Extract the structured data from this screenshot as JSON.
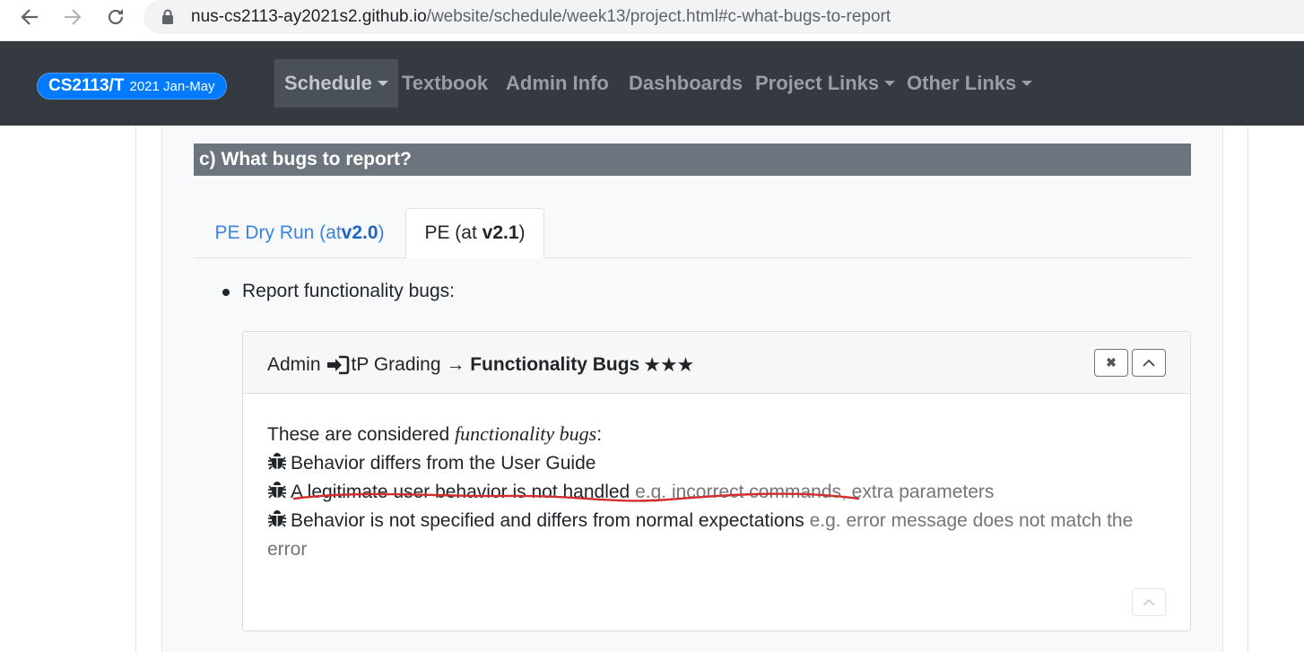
{
  "browser": {
    "url_host": "nus-cs2113-ay2021s2.github.io",
    "url_path": "/website/schedule/week13/project.html#c-what-bugs-to-report"
  },
  "navbar": {
    "brand_main": "CS2113/T",
    "brand_sub": "2021 Jan-May",
    "brand_color": "#007bff",
    "background": "#343a40",
    "items": [
      {
        "label": "Schedule",
        "dropdown": true,
        "active": true
      },
      {
        "label": "Textbook",
        "dropdown": false
      },
      {
        "label": "Admin Info",
        "dropdown": false
      },
      {
        "label": "Dashboards",
        "dropdown": false
      },
      {
        "label": "Project Links",
        "dropdown": true
      },
      {
        "label": "Other Links",
        "dropdown": true
      }
    ]
  },
  "section": {
    "heading": "c) What bugs to report?"
  },
  "tabs": [
    {
      "prefix": "PE Dry Run (at ",
      "version": "v2.0",
      "suffix": ")",
      "active": false
    },
    {
      "prefix": "PE (at ",
      "version": "v2.1",
      "suffix": ")",
      "active": true
    }
  ],
  "bullet": {
    "text": "Report functionality bugs:"
  },
  "card": {
    "title_prefix": "Admin",
    "title_icon": "login-icon",
    "title_middle": "tP Grading →",
    "title_bold": "Functionality Bugs",
    "stars": "★★★",
    "close_icon": "close-icon",
    "collapse_icon": "chevron-up-icon",
    "intro_prefix": "These are considered ",
    "intro_italic": "functionality bugs",
    "intro_suffix": ":",
    "bug_icon": "bug-icon",
    "items": [
      {
        "text": "Behavior differs from the User Guide",
        "muted": ""
      },
      {
        "text": "A legitimate user behavior is not handled",
        "muted": " e.g. incorrect commands, extra parameters"
      },
      {
        "text": "Behavior is not specified and differs from normal expectations",
        "muted": " e.g. error message does not match the error"
      }
    ]
  },
  "annotation": {
    "color": "#d32f2f"
  }
}
